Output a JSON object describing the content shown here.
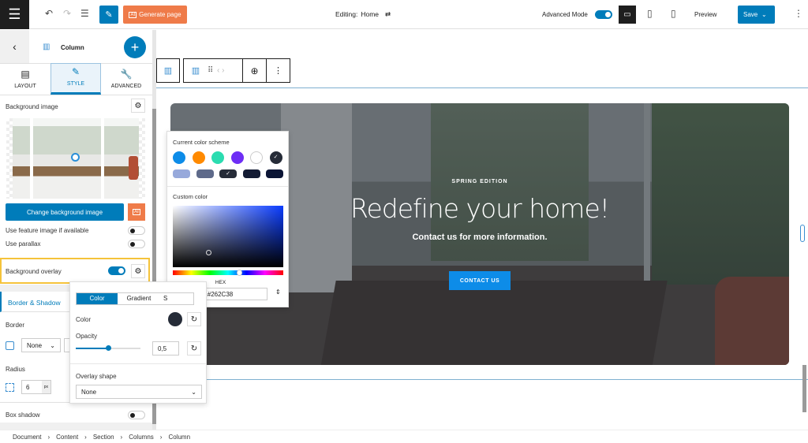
{
  "topbar": {
    "generate_label": "Generate page",
    "editing_label": "Editing:",
    "editing_page": "Home",
    "advanced_mode_label": "Advanced Mode",
    "advanced_mode": true,
    "preview_label": "Preview",
    "save_label": "Save"
  },
  "panel": {
    "title": "Column",
    "tabs": [
      {
        "label": "LAYOUT"
      },
      {
        "label": "STYLE",
        "active": true
      },
      {
        "label": "ADVANCED"
      }
    ],
    "background_image_label": "Background image",
    "change_bg_label": "Change background image",
    "use_feature_image_label": "Use feature image if available",
    "use_feature_image": false,
    "use_parallax_label": "Use parallax",
    "use_parallax": false,
    "background_overlay_label": "Background overlay",
    "background_overlay": true,
    "border_shadow_label": "Border & Shadow",
    "border_label": "Border",
    "border_style": "None",
    "radius_label": "Radius",
    "radius_value": "6",
    "radius_unit": "px",
    "box_shadow_label": "Box shadow",
    "box_shadow": false
  },
  "overlay_popup": {
    "tabs": [
      "Color",
      "Gradient",
      "S"
    ],
    "color_label": "Color",
    "color_value": "#262C38",
    "opacity_label": "Opacity",
    "opacity_value": "0,5",
    "opacity": 0.5,
    "overlay_shape_label": "Overlay shape",
    "overlay_shape_value": "None"
  },
  "color_picker": {
    "scheme_label": "Current color scheme",
    "custom_label": "Custom color",
    "hex_label": "HEX",
    "hex_value": "#262C38",
    "scheme_colors": [
      "#0d8ce8",
      "#ff8a00",
      "#2bdcb0",
      "#6e2ef5",
      "#ffffff",
      "#262c38"
    ],
    "shade_colors": [
      "#97a9db",
      "#5e6a8a",
      "#262c38",
      "#141c34",
      "#0b1535"
    ]
  },
  "hero": {
    "eyebrow": "SPRING EDITION",
    "heading": "Redefine your home!",
    "subheading": "Contact us for more information.",
    "cta_label": "CONTACT US",
    "cta_color": "#0d8ce8"
  },
  "breadcrumb": [
    "Document",
    "Content",
    "Section",
    "Columns",
    "Column"
  ],
  "colors": {
    "accent": "#007cba",
    "generate": "#ef7b49",
    "highlight": "#f5c33b"
  }
}
